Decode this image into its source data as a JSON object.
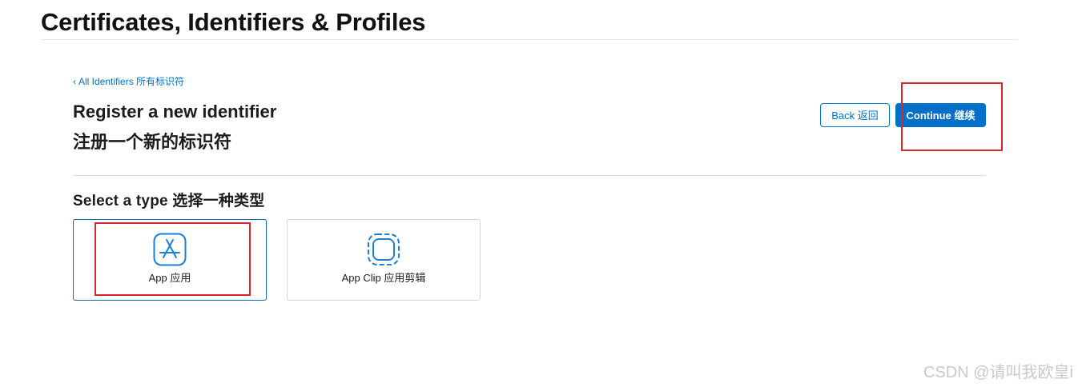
{
  "header": {
    "title": "Certificates, Identifiers & Profiles"
  },
  "breadcrumb": {
    "chevron": "‹",
    "label": "All Identifiers  所有标识符"
  },
  "heading": {
    "title_en": "Register a new identifier",
    "title_zh": "注册一个新的标识符"
  },
  "actions": {
    "back_label": "Back  返回",
    "continue_label": "Continue  继续"
  },
  "select_type": {
    "title": "Select a type  选择一种类型",
    "options": [
      {
        "label": "App  应用",
        "icon": "app-store-icon",
        "selected": true
      },
      {
        "label": "App Clip  应用剪辑",
        "icon": "app-clip-icon",
        "selected": false
      }
    ]
  },
  "watermark": "CSDN @请叫我欧皇i",
  "colors": {
    "accent": "#0070c9",
    "annotation": "#d9262c",
    "icon_blue": "#1e7fd8"
  }
}
